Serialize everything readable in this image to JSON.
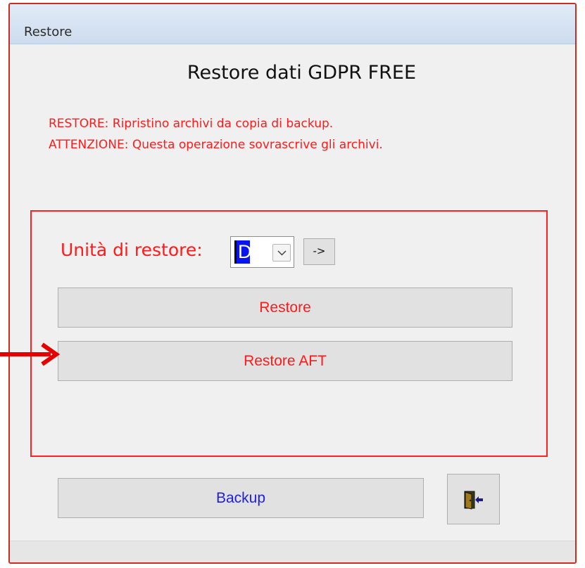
{
  "window": {
    "title": "Restore"
  },
  "heading": "Restore dati GDPR FREE",
  "notice": {
    "line1": "RESTORE: Ripristino archivi da copia di backup.",
    "line2": "ATTENZIONE: Questa operazione sovrascrive gli archivi."
  },
  "restore_group": {
    "drive_label": "Unità di restore:",
    "drive_value": "D",
    "go_label": "->",
    "restore_label": "Restore",
    "restore_aft_label": "Restore AFT"
  },
  "footer": {
    "backup_label": "Backup",
    "exit_icon": "exit-door-icon"
  },
  "colors": {
    "frame": "#d22a1e",
    "warning_text": "#ff1a1a",
    "backup_text": "#1f1fe0",
    "selection": "#0a14f0",
    "annotation_arrow": "#e60000"
  }
}
